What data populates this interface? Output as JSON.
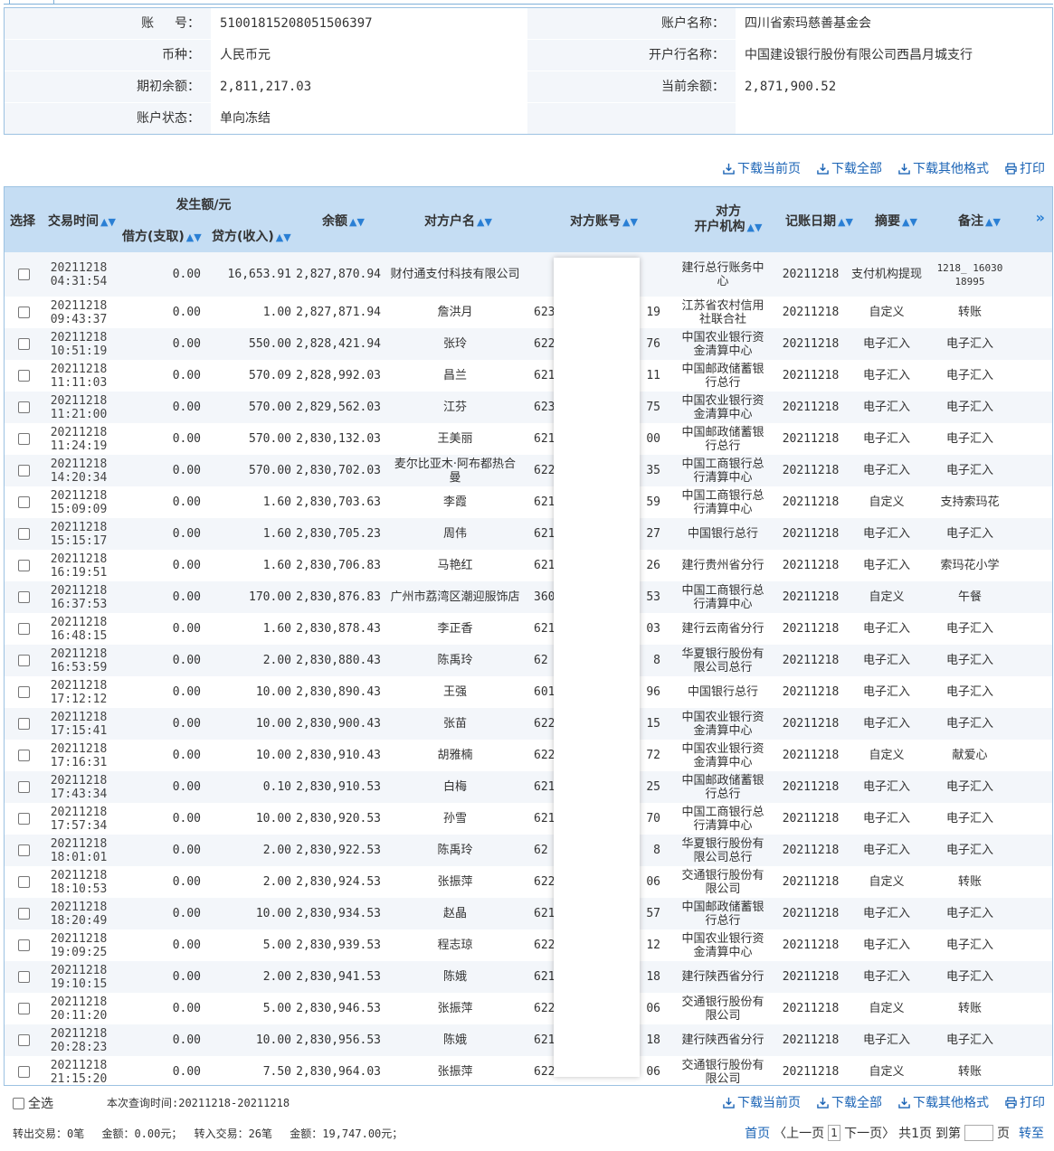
{
  "info": {
    "rows": [
      {
        "l1": "账 　 号：",
        "v1": "51001815208051506397",
        "l2": "账户名称：",
        "v2": "四川省索玛慈善基金会"
      },
      {
        "l1": "币种：",
        "v1": "人民币元",
        "l2": "开户行名称：",
        "v2": "中国建设银行股份有限公司西昌月城支行"
      },
      {
        "l1": "期初余额：",
        "v1": "2,811,217.03",
        "l2": "当前余额：",
        "v2": "2,871,900.52"
      },
      {
        "l1": "账户状态：",
        "v1": "单向冻结",
        "l2": "",
        "v2": ""
      }
    ]
  },
  "toolbar": {
    "download_page": "下载当前页",
    "download_all": "下载全部",
    "download_other": "下载其他格式",
    "print": "打印"
  },
  "table": {
    "headers": {
      "select": "选择",
      "time": "交易时间",
      "amount_group": "发生额/元",
      "debit": "借方(支取)",
      "credit": "贷方(收入)",
      "balance": "余额",
      "name": "对方户名",
      "account": "对方账号",
      "institution_1": "对方",
      "institution_2": "开户机构",
      "date": "记账日期",
      "summary": "摘要",
      "note": "备注",
      "more": "»"
    },
    "rows": [
      {
        "d": "20211218",
        "t": "04:31:54",
        "debit": "0.00",
        "credit": "16,653.91",
        "bal": "2,827,870.94",
        "name": "财付通支付科技有限公司",
        "a1": "",
        "a2": "",
        "inst": "建行总行账务中心",
        "date": "20211218",
        "sum": "支付机构提现",
        "note": "1218_ 16030 18995"
      },
      {
        "d": "20211218",
        "t": "09:43:37",
        "debit": "0.00",
        "credit": "1.00",
        "bal": "2,827,871.94",
        "name": "詹洪月",
        "a1": "6230",
        "a2": "19",
        "inst": "江苏省农村信用社联合社",
        "date": "20211218",
        "sum": "自定义",
        "note": "转账"
      },
      {
        "d": "20211218",
        "t": "10:51:19",
        "debit": "0.00",
        "credit": "550.00",
        "bal": "2,828,421.94",
        "name": "张玲",
        "a1": "6228",
        "a2": "76",
        "inst": "中国农业银行资金清算中心",
        "date": "20211218",
        "sum": "电子汇入",
        "note": "电子汇入"
      },
      {
        "d": "20211218",
        "t": "11:11:03",
        "debit": "0.00",
        "credit": "570.09",
        "bal": "2,828,992.03",
        "name": "昌兰",
        "a1": "621",
        "a2": "11",
        "inst": "中国邮政储蓄银行总行",
        "date": "20211218",
        "sum": "电子汇入",
        "note": "电子汇入"
      },
      {
        "d": "20211218",
        "t": "11:21:00",
        "debit": "0.00",
        "credit": "570.00",
        "bal": "2,829,562.03",
        "name": "江芬",
        "a1": "6230",
        "a2": "75",
        "inst": "中国农业银行资金清算中心",
        "date": "20211218",
        "sum": "电子汇入",
        "note": "电子汇入"
      },
      {
        "d": "20211218",
        "t": "11:24:19",
        "debit": "0.00",
        "credit": "570.00",
        "bal": "2,830,132.03",
        "name": "王美丽",
        "a1": "621",
        "a2": "00",
        "inst": "中国邮政储蓄银行总行",
        "date": "20211218",
        "sum": "电子汇入",
        "note": "电子汇入"
      },
      {
        "d": "20211218",
        "t": "14:20:34",
        "debit": "0.00",
        "credit": "570.00",
        "bal": "2,830,702.03",
        "name": "麦尔比亚木·阿布都热合曼",
        "a1": "6222",
        "a2": "35",
        "inst": "中国工商银行总行清算中心",
        "date": "20211218",
        "sum": "电子汇入",
        "note": "电子汇入"
      },
      {
        "d": "20211218",
        "t": "15:09:09",
        "debit": "0.00",
        "credit": "1.60",
        "bal": "2,830,703.63",
        "name": "李霞",
        "a1": "6212",
        "a2": "59",
        "inst": "中国工商银行总行清算中心",
        "date": "20211218",
        "sum": "自定义",
        "note": "支持索玛花"
      },
      {
        "d": "20211218",
        "t": "15:15:17",
        "debit": "0.00",
        "credit": "1.60",
        "bal": "2,830,705.23",
        "name": "周伟",
        "a1": "621",
        "a2": "27",
        "inst": "中国银行总行",
        "date": "20211218",
        "sum": "电子汇入",
        "note": "电子汇入"
      },
      {
        "d": "20211218",
        "t": "16:19:51",
        "debit": "0.00",
        "credit": "1.60",
        "bal": "2,830,706.83",
        "name": "马艳红",
        "a1": "621",
        "a2": "26",
        "inst": "建行贵州省分行",
        "date": "20211218",
        "sum": "电子汇入",
        "note": "索玛花小学"
      },
      {
        "d": "20211218",
        "t": "16:37:53",
        "debit": "0.00",
        "credit": "170.00",
        "bal": "2,830,876.83",
        "name": "广州市荔湾区潮迎服饰店",
        "a1": "3602",
        "a2": "53",
        "inst": "中国工商银行总行清算中心",
        "date": "20211218",
        "sum": "自定义",
        "note": "午餐"
      },
      {
        "d": "20211218",
        "t": "16:48:15",
        "debit": "0.00",
        "credit": "1.60",
        "bal": "2,830,878.43",
        "name": "李正香",
        "a1": "621",
        "a2": "03",
        "inst": "建行云南省分行",
        "date": "20211218",
        "sum": "电子汇入",
        "note": "电子汇入"
      },
      {
        "d": "20211218",
        "t": "16:53:59",
        "debit": "0.00",
        "credit": "2.00",
        "bal": "2,830,880.43",
        "name": "陈禹玲",
        "a1": "62",
        "a2": "8",
        "inst": "华夏银行股份有限公司总行",
        "date": "20211218",
        "sum": "电子汇入",
        "note": "电子汇入"
      },
      {
        "d": "20211218",
        "t": "17:12:12",
        "debit": "0.00",
        "credit": "10.00",
        "bal": "2,830,890.43",
        "name": "王强",
        "a1": "6013",
        "a2": "96",
        "inst": "中国银行总行",
        "date": "20211218",
        "sum": "电子汇入",
        "note": "电子汇入"
      },
      {
        "d": "20211218",
        "t": "17:15:41",
        "debit": "0.00",
        "credit": "10.00",
        "bal": "2,830,900.43",
        "name": "张苗",
        "a1": "6228",
        "a2": "15",
        "inst": "中国农业银行资金清算中心",
        "date": "20211218",
        "sum": "电子汇入",
        "note": "电子汇入"
      },
      {
        "d": "20211218",
        "t": "17:16:31",
        "debit": "0.00",
        "credit": "10.00",
        "bal": "2,830,910.43",
        "name": "胡雅楠",
        "a1": "6228",
        "a2": "72",
        "inst": "中国农业银行资金清算中心",
        "date": "20211218",
        "sum": "自定义",
        "note": "献爱心"
      },
      {
        "d": "20211218",
        "t": "17:43:34",
        "debit": "0.00",
        "credit": "0.10",
        "bal": "2,830,910.53",
        "name": "白梅",
        "a1": "621",
        "a2": "25",
        "inst": "中国邮政储蓄银行总行",
        "date": "20211218",
        "sum": "电子汇入",
        "note": "电子汇入"
      },
      {
        "d": "20211218",
        "t": "17:57:34",
        "debit": "0.00",
        "credit": "10.00",
        "bal": "2,830,920.53",
        "name": "孙雪",
        "a1": "6212",
        "a2": "70",
        "inst": "中国工商银行总行清算中心",
        "date": "20211218",
        "sum": "电子汇入",
        "note": "电子汇入"
      },
      {
        "d": "20211218",
        "t": "18:01:01",
        "debit": "0.00",
        "credit": "2.00",
        "bal": "2,830,922.53",
        "name": "陈禹玲",
        "a1": "62",
        "a2": "8",
        "inst": "华夏银行股份有限公司总行",
        "date": "20211218",
        "sum": "电子汇入",
        "note": "电子汇入"
      },
      {
        "d": "20211218",
        "t": "18:10:53",
        "debit": "0.00",
        "credit": "2.00",
        "bal": "2,830,924.53",
        "name": "张振萍",
        "a1": "6222",
        "a2": "06",
        "inst": "交通银行股份有限公司",
        "date": "20211218",
        "sum": "自定义",
        "note": "转账"
      },
      {
        "d": "20211218",
        "t": "18:20:49",
        "debit": "0.00",
        "credit": "10.00",
        "bal": "2,830,934.53",
        "name": "赵晶",
        "a1": "621",
        "a2": "57",
        "inst": "中国邮政储蓄银行总行",
        "date": "20211218",
        "sum": "电子汇入",
        "note": "电子汇入"
      },
      {
        "d": "20211218",
        "t": "19:09:25",
        "debit": "0.00",
        "credit": "5.00",
        "bal": "2,830,939.53",
        "name": "程志琼",
        "a1": "6228",
        "a2": "12",
        "inst": "中国农业银行资金清算中心",
        "date": "20211218",
        "sum": "电子汇入",
        "note": "电子汇入"
      },
      {
        "d": "20211218",
        "t": "19:10:15",
        "debit": "0.00",
        "credit": "2.00",
        "bal": "2,830,941.53",
        "name": "陈娥",
        "a1": "621",
        "a2": "18",
        "inst": "建行陕西省分行",
        "date": "20211218",
        "sum": "电子汇入",
        "note": "电子汇入"
      },
      {
        "d": "20211218",
        "t": "20:11:20",
        "debit": "0.00",
        "credit": "5.00",
        "bal": "2,830,946.53",
        "name": "张振萍",
        "a1": "6222",
        "a2": "06",
        "inst": "交通银行股份有限公司",
        "date": "20211218",
        "sum": "自定义",
        "note": "转账"
      },
      {
        "d": "20211218",
        "t": "20:28:23",
        "debit": "0.00",
        "credit": "10.00",
        "bal": "2,830,956.53",
        "name": "陈娥",
        "a1": "621",
        "a2": "18",
        "inst": "建行陕西省分行",
        "date": "20211218",
        "sum": "电子汇入",
        "note": "电子汇入"
      },
      {
        "d": "20211218",
        "t": "21:15:20",
        "debit": "0.00",
        "credit": "7.50",
        "bal": "2,830,964.03",
        "name": "张振萍",
        "a1": "6222",
        "a2": "06",
        "inst": "交通银行股份有限公司",
        "date": "20211218",
        "sum": "自定义",
        "note": "转账"
      }
    ]
  },
  "footer": {
    "select_all": "全选",
    "query_time": "本次查询时间:20211218-20211218",
    "summary": "转出交易：0笔　 金额：0.00元；　 转入交易：26笔　 金额：19,747.00元；",
    "pager": {
      "first": "首页",
      "prev": "〈上一页",
      "current": "1",
      "next": "下一页〉",
      "total": "共1页",
      "goto": "到第",
      "page_unit": "页",
      "go": "转至"
    }
  }
}
